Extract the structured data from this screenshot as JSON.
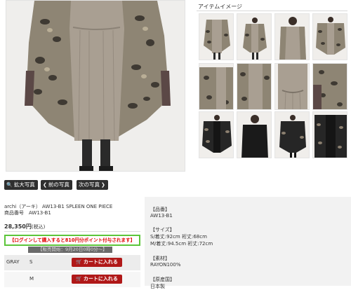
{
  "gallery": {
    "title": "アイテムイメージ"
  },
  "photo_nav": {
    "zoom_label": "拡大写真",
    "prev_label": "前の写真",
    "next_label": "次の写真"
  },
  "product": {
    "brand_line": "archi（アーキ） AW13-B1 SPLEEN ONE PIECE",
    "code_line": "商品番号　AW13-B1",
    "price": "28,350円",
    "tax_note": "(税込)",
    "points_message": "【ログインして購入すると810円分ポイント付与されます】",
    "reserve_note": "【販売開始：9月20日0時0分〜】"
  },
  "stock": [
    {
      "color": "GRAY",
      "size": "S",
      "button": "カートに入れる"
    },
    {
      "color": "",
      "size": "M",
      "button": "カートに入れる"
    }
  ],
  "details": {
    "code_label": "【品番】",
    "code_value": "AW13-B1",
    "size_label": "【サイズ】",
    "size_s": "S/着丈:92cm 裄丈:68cm",
    "size_m": "M/着丈:94.5cm 裄丈:72cm",
    "material_label": "【素材】",
    "material_value": "RAYON100%",
    "origin_label": "【原産国】",
    "origin_value": "日本製"
  },
  "colors": {
    "cart_button": "#b01818",
    "points_border": "#5cc53a",
    "points_text": "#e00000",
    "nav_button": "#2f2f2f"
  }
}
